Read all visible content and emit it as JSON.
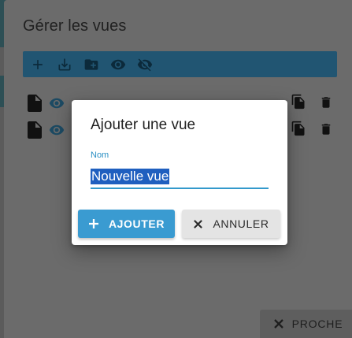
{
  "panel": {
    "title": "Gérer les vues",
    "toolbar_icons": [
      "add-icon",
      "download-icon",
      "new-folder-icon",
      "show-icon",
      "hide-icon"
    ],
    "rows": [
      {
        "label": "",
        "icons": [
          "document-icon",
          "visibility-icon",
          "copy-icon",
          "delete-icon"
        ]
      },
      {
        "label": "",
        "icons": [
          "document-icon",
          "visibility-icon",
          "copy-icon",
          "delete-icon"
        ]
      }
    ],
    "close_label": "PROCHE"
  },
  "dialog": {
    "title": "Ajouter une vue",
    "field_label": "Nom",
    "field_value": "Nouvelle vue",
    "add_label": "AJOUTER",
    "cancel_label": "ANNULER"
  },
  "colors": {
    "accent": "#3a9bd1",
    "overlay": "#6b6b6b",
    "selection": "#1f5fbf"
  }
}
